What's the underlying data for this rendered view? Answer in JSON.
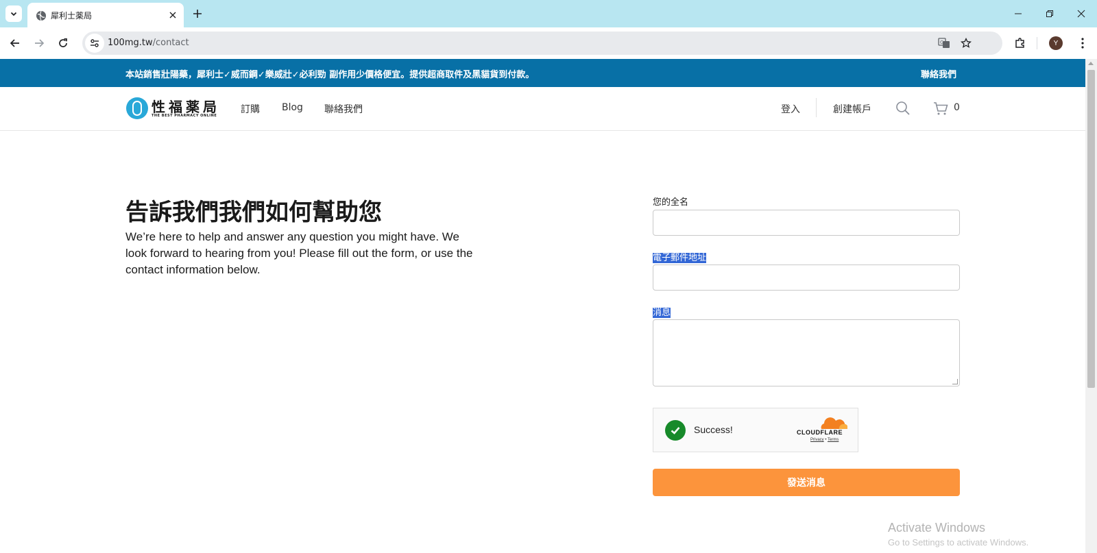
{
  "browser": {
    "tab_title": "犀利士薬局",
    "url_host": "100mg.tw",
    "url_path": "/contact",
    "profile_initial": "Y"
  },
  "announcement": {
    "text": "本站銷售壯陽藥，犀利士✓威而鋼✓樂威壯✓必利勁 副作用少價格便宜。提供超商取件及黑貓貨到付款。",
    "contact_link": "聯絡我們"
  },
  "header": {
    "logo_name": "性福薬局",
    "logo_tagline": "THE BEST PHARMACY ONLINE",
    "nav": [
      "訂購",
      "Blog",
      "聯絡我們"
    ],
    "login": "登入",
    "create_account": "創建帳戶",
    "cart_count": "0"
  },
  "intro": {
    "title": "告訴我們我們如何幫助您",
    "text": "We’re here to help and answer any question you might have. We look forward to hearing from you! Please fill out the form, or use the contact information below."
  },
  "form": {
    "name_label": "您的全名",
    "email_label": "電子郵件地址",
    "message_label": "消息",
    "captcha_status": "Success!",
    "captcha_brand": "CLOUDFLARE",
    "captcha_privacy": "Privacy",
    "captcha_sep": "•",
    "captcha_terms": "Terms",
    "submit_label": "發送消息"
  },
  "watermark": {
    "title": "Activate Windows",
    "subtitle": "Go to Settings to activate Windows."
  },
  "colors": {
    "announce_bg": "#0870a6",
    "button_bg": "#fc943c",
    "tabstrip_bg": "#b8e6f1",
    "logo_accent": "#29a8d8",
    "captcha_check": "#178a2a"
  }
}
